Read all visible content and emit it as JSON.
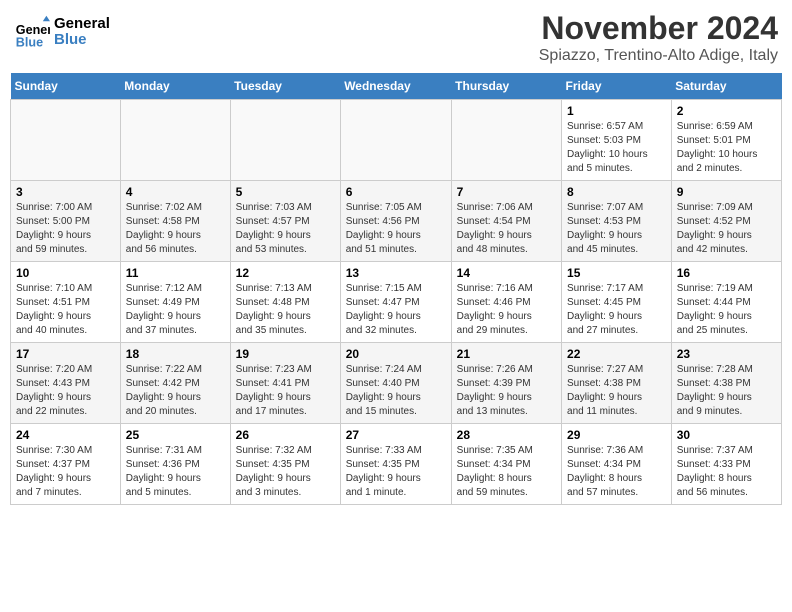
{
  "header": {
    "logo_line1": "General",
    "logo_line2": "Blue",
    "month": "November 2024",
    "location": "Spiazzo, Trentino-Alto Adige, Italy"
  },
  "weekdays": [
    "Sunday",
    "Monday",
    "Tuesday",
    "Wednesday",
    "Thursday",
    "Friday",
    "Saturday"
  ],
  "weeks": [
    [
      {
        "day": "",
        "info": ""
      },
      {
        "day": "",
        "info": ""
      },
      {
        "day": "",
        "info": ""
      },
      {
        "day": "",
        "info": ""
      },
      {
        "day": "",
        "info": ""
      },
      {
        "day": "1",
        "info": "Sunrise: 6:57 AM\nSunset: 5:03 PM\nDaylight: 10 hours\nand 5 minutes."
      },
      {
        "day": "2",
        "info": "Sunrise: 6:59 AM\nSunset: 5:01 PM\nDaylight: 10 hours\nand 2 minutes."
      }
    ],
    [
      {
        "day": "3",
        "info": "Sunrise: 7:00 AM\nSunset: 5:00 PM\nDaylight: 9 hours\nand 59 minutes."
      },
      {
        "day": "4",
        "info": "Sunrise: 7:02 AM\nSunset: 4:58 PM\nDaylight: 9 hours\nand 56 minutes."
      },
      {
        "day": "5",
        "info": "Sunrise: 7:03 AM\nSunset: 4:57 PM\nDaylight: 9 hours\nand 53 minutes."
      },
      {
        "day": "6",
        "info": "Sunrise: 7:05 AM\nSunset: 4:56 PM\nDaylight: 9 hours\nand 51 minutes."
      },
      {
        "day": "7",
        "info": "Sunrise: 7:06 AM\nSunset: 4:54 PM\nDaylight: 9 hours\nand 48 minutes."
      },
      {
        "day": "8",
        "info": "Sunrise: 7:07 AM\nSunset: 4:53 PM\nDaylight: 9 hours\nand 45 minutes."
      },
      {
        "day": "9",
        "info": "Sunrise: 7:09 AM\nSunset: 4:52 PM\nDaylight: 9 hours\nand 42 minutes."
      }
    ],
    [
      {
        "day": "10",
        "info": "Sunrise: 7:10 AM\nSunset: 4:51 PM\nDaylight: 9 hours\nand 40 minutes."
      },
      {
        "day": "11",
        "info": "Sunrise: 7:12 AM\nSunset: 4:49 PM\nDaylight: 9 hours\nand 37 minutes."
      },
      {
        "day": "12",
        "info": "Sunrise: 7:13 AM\nSunset: 4:48 PM\nDaylight: 9 hours\nand 35 minutes."
      },
      {
        "day": "13",
        "info": "Sunrise: 7:15 AM\nSunset: 4:47 PM\nDaylight: 9 hours\nand 32 minutes."
      },
      {
        "day": "14",
        "info": "Sunrise: 7:16 AM\nSunset: 4:46 PM\nDaylight: 9 hours\nand 29 minutes."
      },
      {
        "day": "15",
        "info": "Sunrise: 7:17 AM\nSunset: 4:45 PM\nDaylight: 9 hours\nand 27 minutes."
      },
      {
        "day": "16",
        "info": "Sunrise: 7:19 AM\nSunset: 4:44 PM\nDaylight: 9 hours\nand 25 minutes."
      }
    ],
    [
      {
        "day": "17",
        "info": "Sunrise: 7:20 AM\nSunset: 4:43 PM\nDaylight: 9 hours\nand 22 minutes."
      },
      {
        "day": "18",
        "info": "Sunrise: 7:22 AM\nSunset: 4:42 PM\nDaylight: 9 hours\nand 20 minutes."
      },
      {
        "day": "19",
        "info": "Sunrise: 7:23 AM\nSunset: 4:41 PM\nDaylight: 9 hours\nand 17 minutes."
      },
      {
        "day": "20",
        "info": "Sunrise: 7:24 AM\nSunset: 4:40 PM\nDaylight: 9 hours\nand 15 minutes."
      },
      {
        "day": "21",
        "info": "Sunrise: 7:26 AM\nSunset: 4:39 PM\nDaylight: 9 hours\nand 13 minutes."
      },
      {
        "day": "22",
        "info": "Sunrise: 7:27 AM\nSunset: 4:38 PM\nDaylight: 9 hours\nand 11 minutes."
      },
      {
        "day": "23",
        "info": "Sunrise: 7:28 AM\nSunset: 4:38 PM\nDaylight: 9 hours\nand 9 minutes."
      }
    ],
    [
      {
        "day": "24",
        "info": "Sunrise: 7:30 AM\nSunset: 4:37 PM\nDaylight: 9 hours\nand 7 minutes."
      },
      {
        "day": "25",
        "info": "Sunrise: 7:31 AM\nSunset: 4:36 PM\nDaylight: 9 hours\nand 5 minutes."
      },
      {
        "day": "26",
        "info": "Sunrise: 7:32 AM\nSunset: 4:35 PM\nDaylight: 9 hours\nand 3 minutes."
      },
      {
        "day": "27",
        "info": "Sunrise: 7:33 AM\nSunset: 4:35 PM\nDaylight: 9 hours\nand 1 minute."
      },
      {
        "day": "28",
        "info": "Sunrise: 7:35 AM\nSunset: 4:34 PM\nDaylight: 8 hours\nand 59 minutes."
      },
      {
        "day": "29",
        "info": "Sunrise: 7:36 AM\nSunset: 4:34 PM\nDaylight: 8 hours\nand 57 minutes."
      },
      {
        "day": "30",
        "info": "Sunrise: 7:37 AM\nSunset: 4:33 PM\nDaylight: 8 hours\nand 56 minutes."
      }
    ]
  ]
}
